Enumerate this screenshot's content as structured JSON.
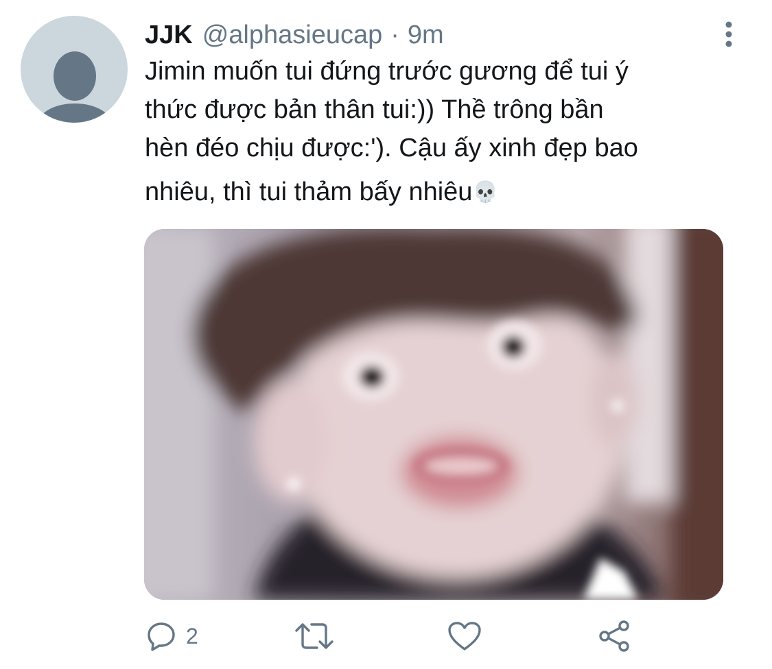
{
  "tweet": {
    "author_name": "JJK",
    "handle": "@alphasieucap",
    "separator": "·",
    "time": "9m",
    "text_lines": [
      "Jimin muốn tui đứng trước gương để tui ý",
      "thức được bản thân tui:)) Thề trông bần",
      "hèn đéo chịu được:'). Cậu ấy xinh đẹp bao",
      "nhiêu, thì tui thảm bấy nhiêu"
    ],
    "emoji": "💀",
    "icons": {
      "avatar": "default-avatar-icon",
      "more": "more-vertical-icon",
      "reply": "reply-icon",
      "retweet": "retweet-icon",
      "like": "heart-icon",
      "share": "share-icon",
      "emoji": "skull-icon"
    },
    "actions": {
      "reply_count": "2"
    },
    "colors": {
      "text": "#14171a",
      "secondary": "#657786",
      "avatar_bg": "#ccd6dd",
      "avatar_fg": "#657786"
    }
  }
}
